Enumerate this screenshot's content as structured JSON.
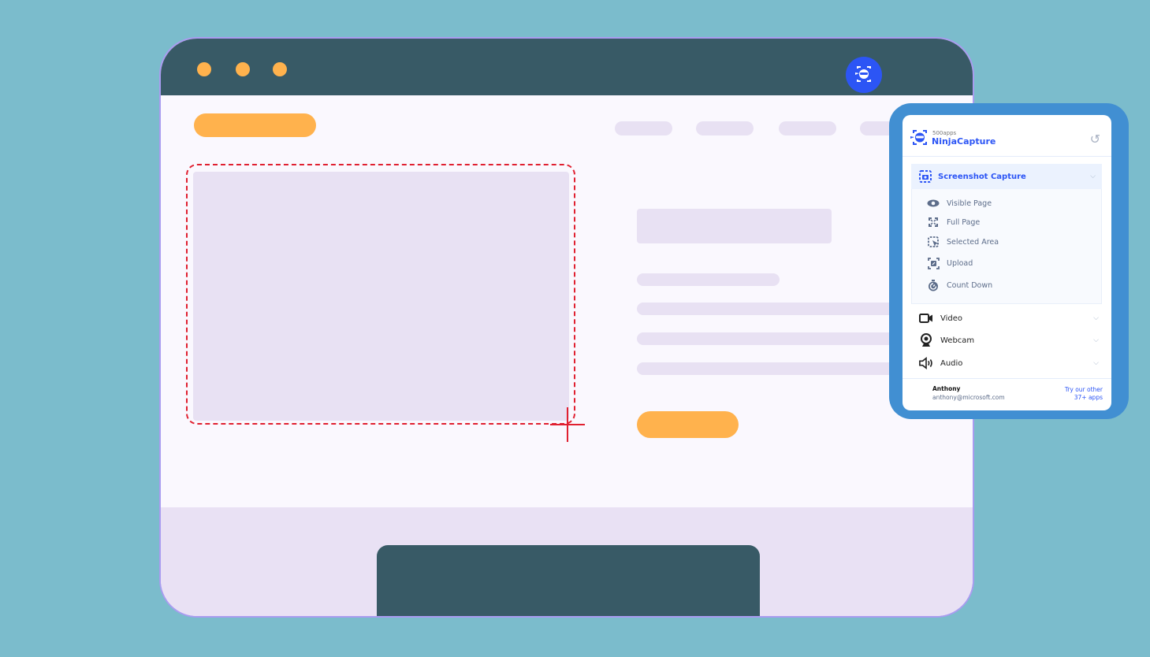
{
  "colors": {
    "background": "#7bbccc",
    "titlebar": "#385a66",
    "accent_orange": "#ffb24d",
    "placeholder": "#e8e1f3",
    "selection_red": "#e02030",
    "brand_blue": "#2c55f5",
    "popup_frame": "#418fd2"
  },
  "extension": {
    "icon": "ninja-capture-icon",
    "brand_small": "500apps",
    "brand_name": "NinjaCapture",
    "history_icon": "history-icon"
  },
  "menu": {
    "screenshot": {
      "label": "Screenshot Capture",
      "icon": "screenshot-capture-icon",
      "items": [
        {
          "label": "Visible Page",
          "icon": "eye-icon"
        },
        {
          "label": "Full Page",
          "icon": "expand-icon"
        },
        {
          "label": "Selected Area",
          "icon": "select-area-icon"
        },
        {
          "label": "Upload",
          "icon": "upload-icon"
        },
        {
          "label": "Count Down",
          "icon": "timer-icon"
        }
      ]
    },
    "video": {
      "label": "Video",
      "icon": "video-camera-icon"
    },
    "webcam": {
      "label": "Webcam",
      "icon": "webcam-icon"
    },
    "audio": {
      "label": "Audio",
      "icon": "speaker-icon"
    }
  },
  "user": {
    "name": "Anthony",
    "email": "anthony@microsoft.com"
  },
  "promo": {
    "line1": "Try our other",
    "line2": "37+ apps"
  }
}
